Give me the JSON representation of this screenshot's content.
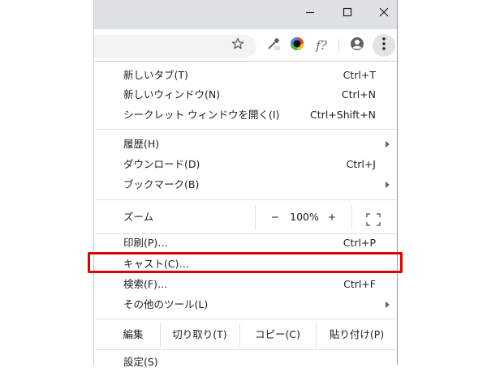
{
  "window_controls": {
    "minimize": "minimize-icon",
    "maximize": "maximize-icon",
    "close": "close-icon"
  },
  "toolbar": {
    "icons": [
      "star-icon",
      "eyedropper-icon",
      "color-wheel-icon",
      "font-finder-icon",
      "profile-icon",
      "more-menu-icon"
    ],
    "font_finder_label": "f?"
  },
  "menu": {
    "new_tab": {
      "label": "新しいタブ(T)",
      "shortcut": "Ctrl+T"
    },
    "new_window": {
      "label": "新しいウィンドウ(N)",
      "shortcut": "Ctrl+N"
    },
    "incognito": {
      "label": "シークレット ウィンドウを開く(I)",
      "shortcut": "Ctrl+Shift+N"
    },
    "history": {
      "label": "履歴(H)"
    },
    "downloads": {
      "label": "ダウンロード(D)",
      "shortcut": "Ctrl+J"
    },
    "bookmarks": {
      "label": "ブックマーク(B)"
    },
    "zoom": {
      "label": "ズーム",
      "minus": "−",
      "value": "100%",
      "plus": "+"
    },
    "print": {
      "label": "印刷(P)…",
      "shortcut": "Ctrl+P"
    },
    "cast": {
      "label": "キャスト(C)…"
    },
    "find": {
      "label": "検索(F)…",
      "shortcut": "Ctrl+F"
    },
    "more_tools": {
      "label": "その他のツール(L)"
    },
    "edit": {
      "label": "編集",
      "cut": "切り取り(T)",
      "copy": "コピー(C)",
      "paste": "貼り付け(P)"
    },
    "settings": {
      "label": "設定(S)"
    }
  },
  "colors": {
    "highlight": "#e00000",
    "titlebar": "#dee1e6",
    "menu_text": "#202124"
  }
}
